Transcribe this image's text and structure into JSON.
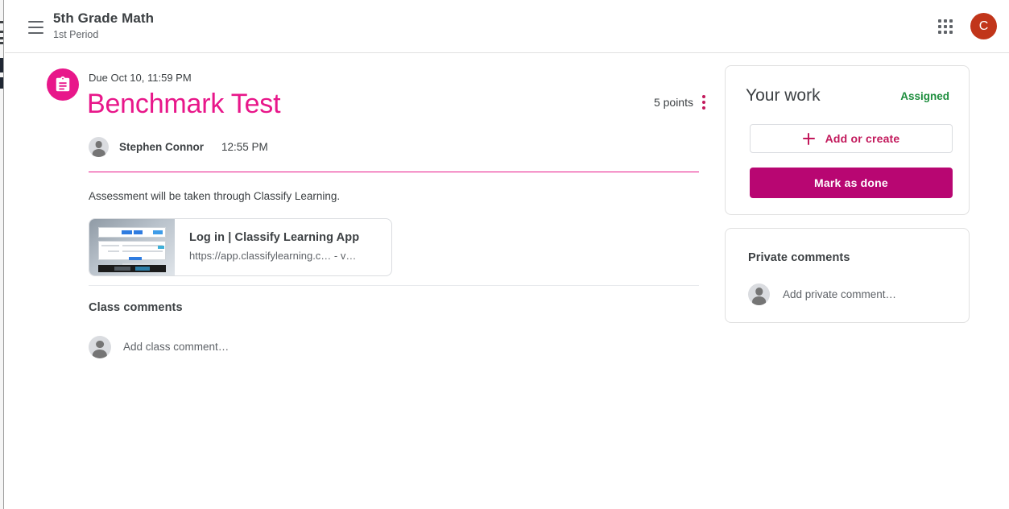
{
  "header": {
    "menu_icon": "hamburger-menu-icon",
    "course_title": "5th Grade Math",
    "course_section": "1st Period",
    "apps_icon": "apps-grid-icon",
    "avatar_initial": "C",
    "avatar_color": "#c1351a"
  },
  "assignment": {
    "icon": "assignment-clipboard-icon",
    "icon_color": "#e8178a",
    "due": "Due Oct 10, 11:59 PM",
    "title": "Benchmark Test",
    "title_color": "#e8178a",
    "points": "5 points",
    "overflow_icon": "more-vert-icon",
    "author": "Stephen Connor",
    "time": "12:55 PM",
    "description": "Assessment will be taken through Classify Learning.",
    "attachment": {
      "title": "Log in | Classify Learning App",
      "url": "https://app.classifylearning.c… - v…",
      "thumbnail": "login-page-screenshot-thumbnail"
    }
  },
  "class_comments": {
    "heading": "Class comments",
    "placeholder": "Add class comment…",
    "avatar_icon": "user-avatar-icon"
  },
  "your_work": {
    "heading": "Your work",
    "status": "Assigned",
    "status_color": "#1e8e3e",
    "add_icon": "plus-icon",
    "add_label": "Add or create",
    "done_label": "Mark as done",
    "done_color": "#b80672"
  },
  "private_comments": {
    "heading": "Private comments",
    "placeholder": "Add private comment…",
    "avatar_icon": "user-avatar-icon"
  }
}
